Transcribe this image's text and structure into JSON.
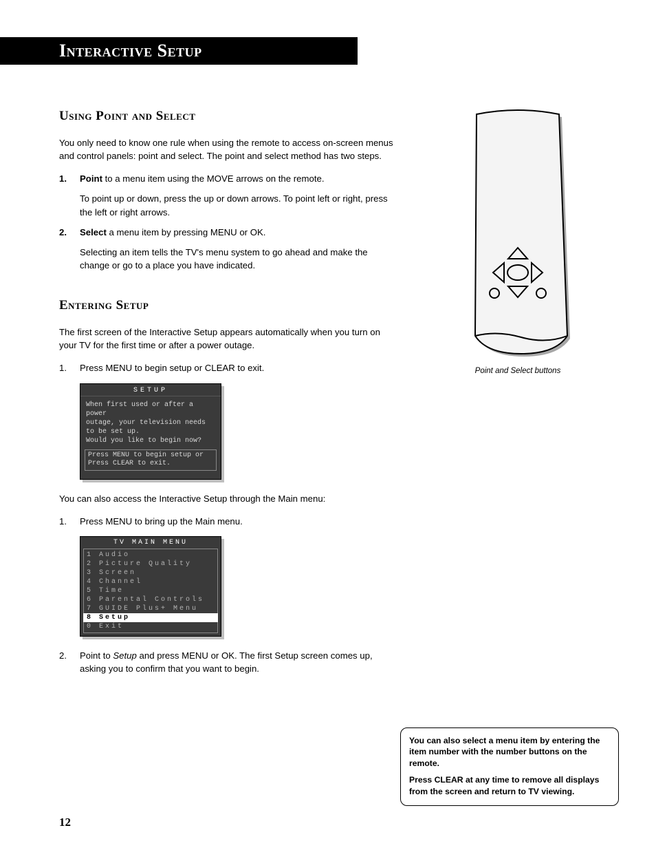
{
  "title": "Interactive Setup",
  "sections": {
    "point_select": {
      "heading": "Using Point and Select",
      "intro": "You only need to know one rule when using the remote to access on-screen menus and control panels: point and select. The point and select method has two steps.",
      "steps": [
        {
          "num": "1.",
          "lead": "Point",
          "rest": " to a menu item using the MOVE arrows on the remote.",
          "after": "To point up or down, press the up or down arrows. To point left or right, press the left or right arrows."
        },
        {
          "num": "2.",
          "lead": "Select",
          "rest": " a menu item by pressing MENU or OK.",
          "after": "Selecting an item tells the TV's menu system to go ahead and make the change or go to a place you have indicated."
        }
      ]
    },
    "entering": {
      "heading": "Entering Setup",
      "intro": "The first screen of the Interactive Setup appears automatically when you turn on your TV for the first time or after a power outage.",
      "step1": {
        "num": "1.",
        "text": "Press MENU to begin setup or CLEAR to exit."
      },
      "after1": "You can also access the Interactive Setup through the Main menu:",
      "step1b": {
        "num": "1.",
        "text": "Press MENU to bring up the Main menu."
      },
      "step2": {
        "num": "2.",
        "text_pre": "Point to ",
        "em": "Setup",
        "text_post": " and press MENU or OK. The first Setup screen comes up, asking you to confirm that you want to begin."
      }
    }
  },
  "osd_setup": {
    "title": "SETUP",
    "body": "When first used or after a power\noutage, your television needs\nto be set up.\nWould you like to begin now?",
    "hint": "Press MENU to begin setup or\nPress CLEAR to exit."
  },
  "osd_main": {
    "title": "TV MAIN MENU",
    "items": [
      {
        "n": "1",
        "label": "Audio"
      },
      {
        "n": "2",
        "label": "Picture Quality"
      },
      {
        "n": "3",
        "label": "Screen"
      },
      {
        "n": "4",
        "label": "Channel"
      },
      {
        "n": "5",
        "label": "Time"
      },
      {
        "n": "6",
        "label": "Parental Controls"
      },
      {
        "n": "7",
        "label": "GUIDE Plus+ Menu"
      },
      {
        "n": "8",
        "label": "Setup",
        "selected": true
      },
      {
        "n": "0",
        "label": "Exit"
      }
    ]
  },
  "remote_caption": "Point and Select buttons",
  "tip": {
    "p1": "You can also select a menu item by entering the item number with the number buttons on the remote.",
    "p2": "Press CLEAR at any time to remove all displays from the screen and return to TV viewing."
  },
  "page_number": "12"
}
